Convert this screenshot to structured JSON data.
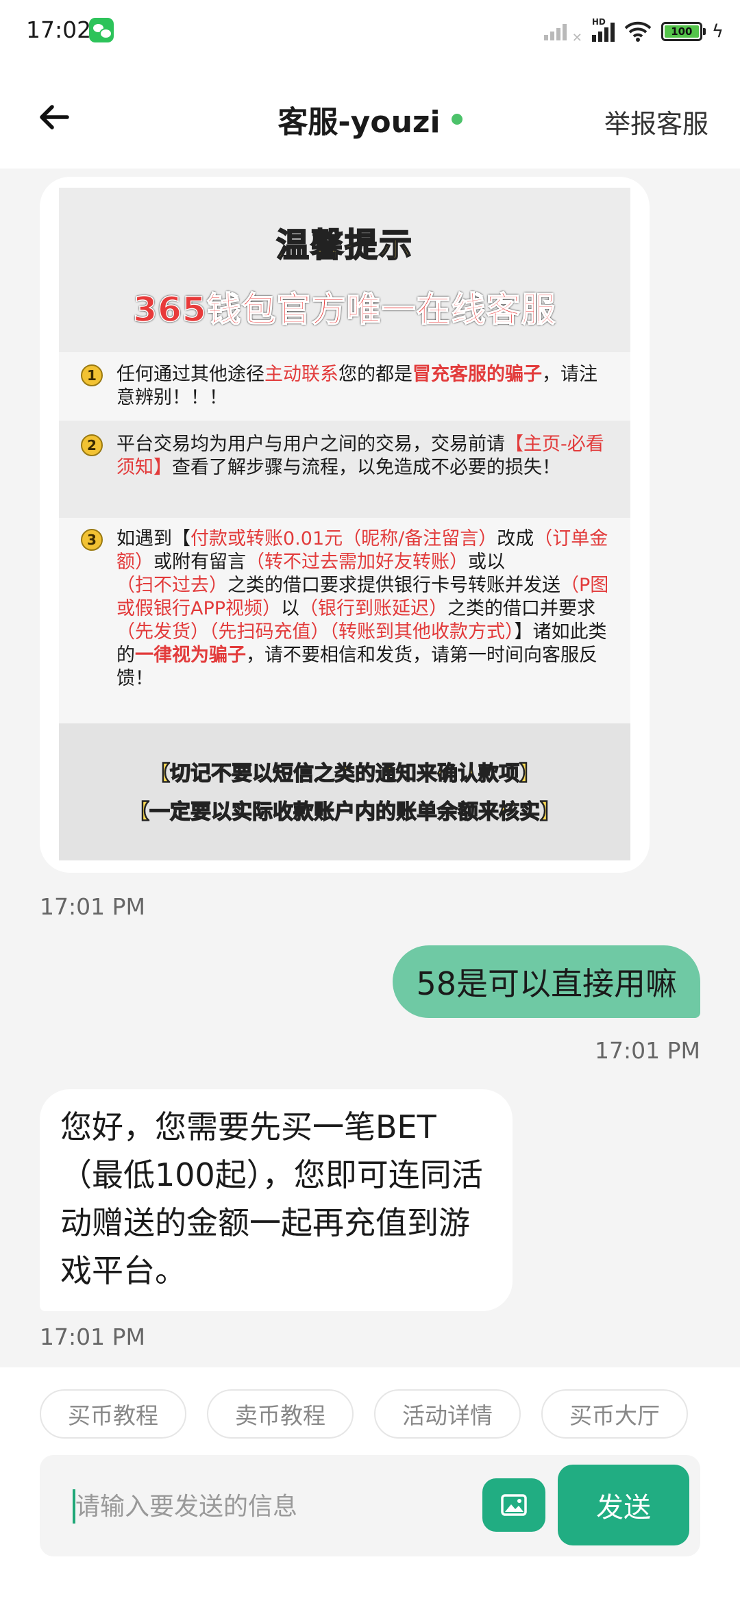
{
  "status_bar": {
    "time": "17:02",
    "network_label": "HD",
    "battery": "100"
  },
  "header": {
    "title": "客服-youzi",
    "report": "举报客服"
  },
  "notice_image": {
    "title": "温馨提示",
    "subtitle": "365钱包官方唯一在线客服",
    "items": [
      {
        "number": "1",
        "parts": [
          "任何通过其他途径",
          "主动联系",
          "您的都是",
          "冒充客服的骗子",
          "，请注意辨别！！！"
        ]
      },
      {
        "number": "2",
        "parts": [
          "平台交易均为用户与用户之间的交易，交易前请",
          "【主页-必看须知】",
          "查看了解步骤与流程，以免造成不必要的损失！"
        ]
      },
      {
        "number": "3",
        "parts": [
          "如遇到【",
          "付款或转账0.01元（昵称/备注留言）",
          "改成",
          "（订单金额）",
          "或附有留言",
          "（转不过去需加好友转账）",
          "或以",
          "（扫不过去）",
          "之类的借口要求提供银行卡号转账并发送",
          "（P图或假银行APP视频）",
          "以",
          "（银行到账延迟）",
          "之类的借口并要求",
          "（先发货）（先扫码充值）（转账到其他收款方式）",
          "】诸如此类的",
          "一律视为骗子",
          "，请不要相信和发货，请第一时间向客服反馈！"
        ]
      }
    ],
    "footer": [
      "【切记不要以短信之类的通知来确认款项】",
      "【一定要以实际收款账户内的账单余额来核实】"
    ]
  },
  "messages": {
    "ts_image": "17:01 PM",
    "outgoing_text": "58是可以直接用嘛",
    "ts_outgoing": "17:01 PM",
    "incoming_text": "您好，您需要先买一笔BET（最低100起），您即可连同活动赠送的金额一起再充值到游戏平台。",
    "ts_incoming": "17:01 PM"
  },
  "quick_replies": [
    "买币教程",
    "卖币教程",
    "活动详情",
    "买币大厅"
  ],
  "composer": {
    "placeholder": "请输入要发送的信息",
    "send": "发送"
  },
  "colors": {
    "accent": "#21ad82",
    "outgoing_bubble": "#6fc9a4",
    "online": "#4cc26a",
    "warning_red": "#e23b3b"
  }
}
